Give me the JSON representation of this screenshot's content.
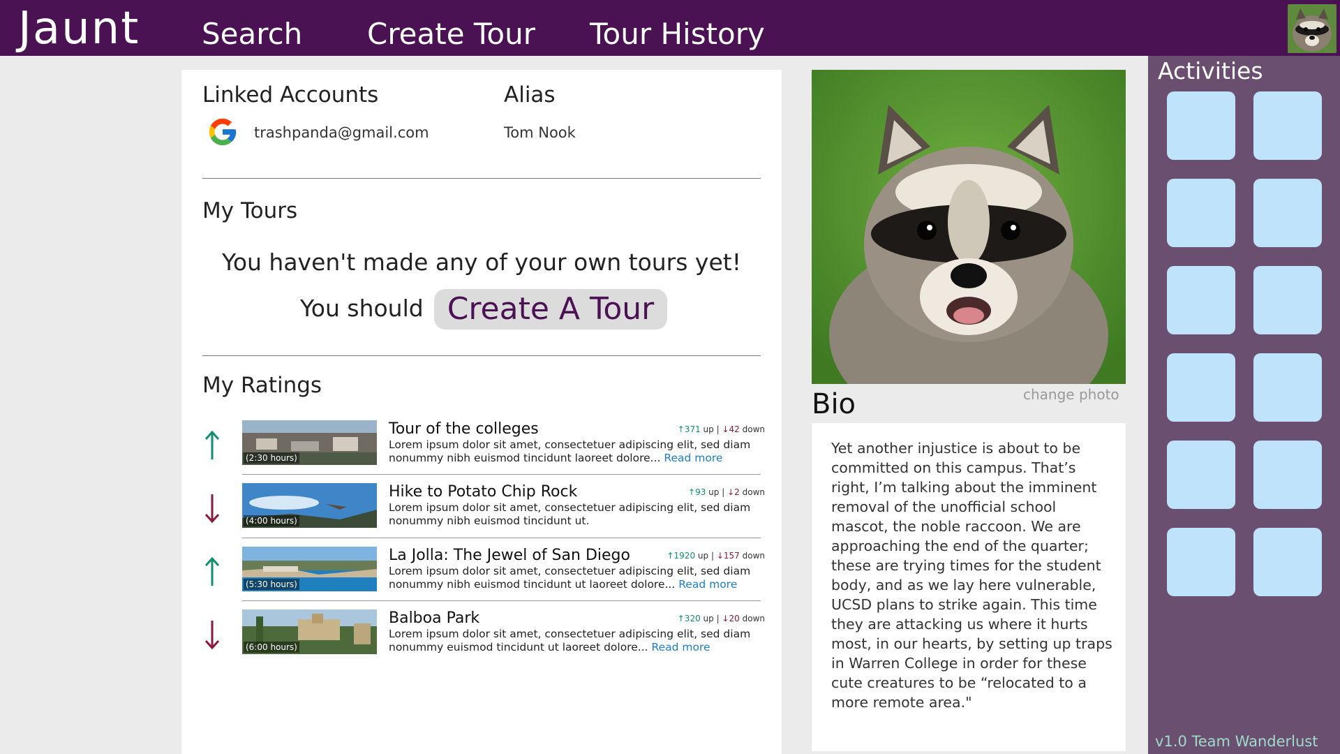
{
  "app": {
    "brand": "Jaunt",
    "nav": [
      "Search",
      "Create Tour",
      "Tour History"
    ]
  },
  "linked_accounts": {
    "title": "Linked Accounts",
    "provider_icon": "google-icon",
    "email": "trashpanda@gmail.com"
  },
  "alias": {
    "title": "Alias",
    "value": "Tom Nook"
  },
  "my_tours": {
    "title": "My Tours",
    "empty_message": "You haven't made any of your own tours yet!",
    "prompt": "You should",
    "cta": "Create A Tour"
  },
  "my_ratings": {
    "title": "My Ratings",
    "items": [
      {
        "vote": "up",
        "title": "Tour of the colleges",
        "duration": "(2:30 hours)",
        "up_votes": "↑371",
        "up_label": "up",
        "down_votes": "↓42",
        "down_label": "down",
        "description": "Lorem ipsum dolor sit amet, consectetuer adipiscing elit, sed diam nonummy nibh euismod tincidunt laoreet dolore...",
        "read_more": "Read more"
      },
      {
        "vote": "down",
        "title": "Hike to Potato Chip Rock",
        "duration": "(4:00 hours)",
        "up_votes": "↑93",
        "up_label": "up",
        "down_votes": "↓2",
        "down_label": "down",
        "description": "Lorem ipsum dolor sit amet, consectetuer adipiscing elit, sed diam nonummy nibh euismod tincidunt ut.",
        "read_more": ""
      },
      {
        "vote": "up",
        "title": "La Jolla: The Jewel of San Diego",
        "duration": "(5:30 hours)",
        "up_votes": "↑1920",
        "up_label": "up",
        "down_votes": "↓157",
        "down_label": "down",
        "description": "Lorem ipsum dolor sit amet, consectetuer adipiscing elit, sed diam nonummy nibh euismod tincidunt ut laoreet dolore...",
        "read_more": "Read more"
      },
      {
        "vote": "down",
        "title": "Balboa Park",
        "duration": "(6:00 hours)",
        "up_votes": "↑320",
        "up_label": "up",
        "down_votes": "↓20",
        "down_label": "down",
        "description": "Lorem ipsum dolor sit amet, consectetuer adipiscing elit, sed diam nonummy euismod tincidunt ut laoreet dolore...",
        "read_more": "Read more"
      }
    ]
  },
  "profile": {
    "photo": "raccoon-photo",
    "change_photo": "change photo",
    "bio_title": "Bio",
    "bio": "Yet another injustice is about to be committed on this campus. That’s right, I’m talking about the imminent removal of the unofficial school mascot, the noble raccoon. We are approaching the end of the quarter; these are trying times for the student body, and as we lay here vulnerable, UCSD plans to strike again. This time they are attacking us where it hurts most, in our hearts, by setting up traps in Warren College in order for these cute creatures to be “relocated to a more remote area.\""
  },
  "activities": {
    "title": "Activities",
    "tile_count": 12
  },
  "footer": {
    "version": "v1.0 Team Wanderlust"
  },
  "colors": {
    "header_bg": "#4a1153",
    "sidebar_bg": "#6b4f70",
    "tile": "#bfe3fb",
    "up_arrow": "#0f8f6f",
    "down_arrow": "#8a1a3a",
    "link": "#1a7fd0",
    "version_text": "#9fdcc8"
  }
}
